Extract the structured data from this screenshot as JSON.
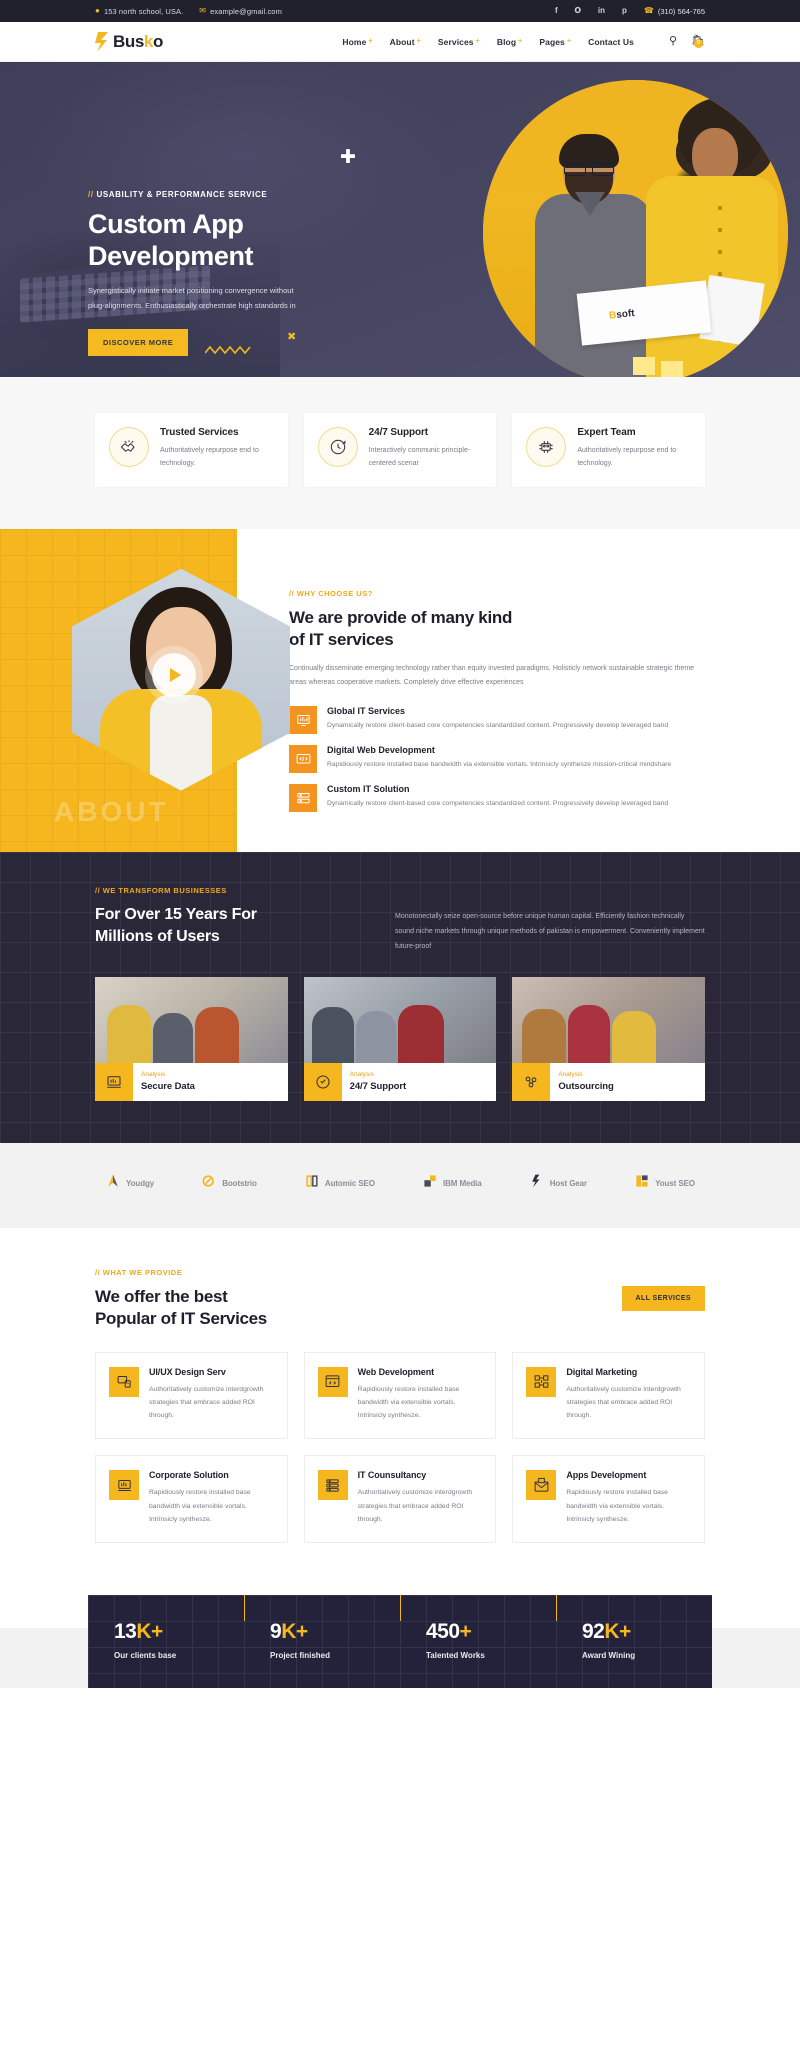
{
  "topbar": {
    "address": "153 north school, USA.",
    "email": "example@gmail.com",
    "phone": "(310) 564-765",
    "socials": [
      "facebook",
      "twitter",
      "linkedin",
      "pinterest"
    ]
  },
  "nav": {
    "logo_text": "Bus",
    "logo_text_k": "k",
    "logo_text_end": "o",
    "items": [
      {
        "label": "Home",
        "caret": "+"
      },
      {
        "label": "About",
        "caret": "+"
      },
      {
        "label": "Services",
        "caret": "+"
      },
      {
        "label": "Blog",
        "caret": "+"
      },
      {
        "label": "Pages",
        "caret": "+"
      },
      {
        "label": "Contact Us",
        "caret": ""
      }
    ],
    "cart_count": "0"
  },
  "hero": {
    "tag_slash": "//",
    "tag": "USABILITY & PERFORMANCE SERVICE",
    "title_line1": "Custom App",
    "title_line2": "Development",
    "desc": "Synergistically initiate market positioning convergence without plug-alignments. Enthusiastically orchestrate high standards in",
    "button": "DISCOVER MORE",
    "paper_brand": "B",
    "paper_brand_rest": "soft"
  },
  "features": [
    {
      "title": "Trusted Services",
      "desc": "Authoritatively repurpose end to technology.",
      "icon": "handshake-icon"
    },
    {
      "title": "24/7 Support",
      "desc": "Interactively communic principle-centered scenar",
      "icon": "clock-support-icon"
    },
    {
      "title": "Expert Team",
      "desc": "Authoritatively repurpose end to technology.",
      "icon": "team-icon"
    }
  ],
  "why": {
    "watermark": "ABOUT",
    "tag_slash": "//",
    "tag": "WHY CHOOSE US?",
    "title_line1": "We are provide of many kind",
    "title_line2": "of IT services",
    "desc": "Continually disseminate emerging technology rather than equity invested paradigms. Holisticly network sustainable strategic theme areas whereas cooperative markets. Completely drive effective experiences",
    "services": [
      {
        "title": "Global IT Services",
        "desc": "Dynamically restore client-based core competencies standardized content. Progressively develop leveraged band",
        "icon": "monitor-chart-icon"
      },
      {
        "title": "Digital Web Development",
        "desc": "Rapidiously restore installed base bandwidth via extensible vortals. Intrinsicly synthesze mission-critical mindshare",
        "icon": "code-window-icon"
      },
      {
        "title": "Custom IT Solution",
        "desc": "Dynamically restore client-based core competencies standardized content. Progressively develop leveraged band",
        "icon": "server-gear-icon"
      }
    ]
  },
  "transform": {
    "tag_slash": "//",
    "tag": "WE TRANSFORM BUSINESSES",
    "title_line1": "For Over 15 Years For",
    "title_line2": "Millions of Users",
    "desc": "Monotonectally seize open-source before unique human capital. Efficiently fashion technically sound niche markets through unique methods of pakistan is empowerment. Conveniently implement future-proof",
    "cards": [
      {
        "sub": "Analysis",
        "name": "Secure Data",
        "icon": "laptop-chart-icon"
      },
      {
        "sub": "Analysis",
        "name": "24/7 Support",
        "icon": "clock-24-icon"
      },
      {
        "sub": "Analysis",
        "name": "Outsourcing",
        "icon": "network-people-icon"
      }
    ]
  },
  "brands": [
    {
      "name": "Youdgy",
      "icon": "youdgy-logo-icon"
    },
    {
      "name": "Bootstrio",
      "icon": "bootstrio-logo-icon"
    },
    {
      "name": "Automic SEO",
      "icon": "automic-seo-logo-icon"
    },
    {
      "name": "IBM Media",
      "icon": "ibm-media-logo-icon"
    },
    {
      "name": "Host Gear",
      "icon": "host-gear-logo-icon"
    },
    {
      "name": "Youst SEO",
      "icon": "youst-seo-logo-icon"
    }
  ],
  "services_section": {
    "tag_slash": "//",
    "tag": "WHAT WE PROVIDE",
    "title_line1": "We offer the best",
    "title_line2": "Popular of IT Services",
    "all_button": "ALL SERVICES",
    "cards": [
      {
        "title": "UI/UX Design Serv",
        "desc": "Authoritatively customize interdgrowth strategies that embrace added ROI through.",
        "icon": "ui-design-icon"
      },
      {
        "title": "Web Development",
        "desc": "Rapidiously restore installed base bandwidth via extensible vortals. Intrinsicly synthesze.",
        "icon": "code-browser-icon"
      },
      {
        "title": "Digital Marketing",
        "desc": "Authoritatively customize interdgrowth strategies that embrace added ROI through.",
        "icon": "marketing-network-icon"
      },
      {
        "title": "Corporate Solution",
        "desc": "Rapidiously restore installed base bandwidth via extensible vortals. Intrinsicly synthesze.",
        "icon": "corporate-chart-icon"
      },
      {
        "title": "IT Counsultancy",
        "desc": "Authoritatively customize interdgrowth strategies that embrace added ROI through.",
        "icon": "server-stack-icon"
      },
      {
        "title": "Apps Development",
        "desc": "Rapidiously restore installed base bandwidth via extensible vortals. Intrinsicly synthesze.",
        "icon": "envelope-doc-icon"
      }
    ]
  },
  "counters": [
    {
      "num": "13",
      "unit": "K",
      "plus": "+",
      "label": "Our clients base"
    },
    {
      "num": "9",
      "unit": "K",
      "plus": "+",
      "label": "Project finished"
    },
    {
      "num": "450",
      "unit": "",
      "plus": "+",
      "label": "Talented Works"
    },
    {
      "num": "92",
      "unit": "K",
      "plus": "+",
      "label": "Award Wining"
    }
  ],
  "colors": {
    "accent": "#f5b61e",
    "orange": "#f39420",
    "dark": "#23223a",
    "topbar": "#21212e"
  }
}
